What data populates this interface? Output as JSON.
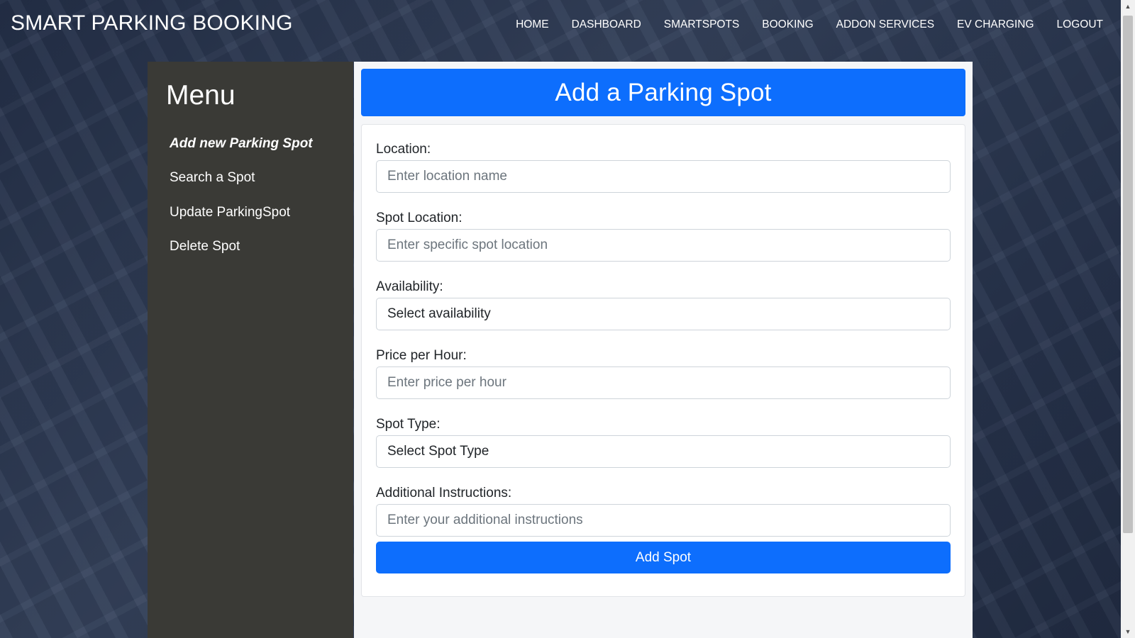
{
  "header": {
    "brand": "SMART PARKING BOOKING",
    "nav": [
      "HOME",
      "DASHBOARD",
      "SMARTSPOTS",
      "BOOKING",
      "ADDON SERVICES",
      "EV CHARGING",
      "LOGOUT"
    ]
  },
  "sidebar": {
    "title": "Menu",
    "items": [
      "Add new Parking Spot",
      "Search a Spot",
      "Update ParkingSpot",
      "Delete Spot"
    ],
    "active_index": 0
  },
  "main": {
    "title": "Add a Parking Spot",
    "form": {
      "location": {
        "label": "Location:",
        "placeholder": "Enter location name"
      },
      "spot_location": {
        "label": "Spot Location:",
        "placeholder": "Enter specific spot location"
      },
      "availability": {
        "label": "Availability:",
        "selected": "Select availability"
      },
      "price": {
        "label": "Price per Hour:",
        "placeholder": "Enter price per hour"
      },
      "spot_type": {
        "label": "Spot Type:",
        "selected": "Select Spot Type"
      },
      "instructions": {
        "label": "Additional Instructions:",
        "placeholder": "Enter your additional instructions"
      },
      "submit_label": "Add Spot"
    }
  },
  "colors": {
    "primary": "#0d6efd",
    "sidebar_bg": "#3a3a36",
    "panel_bg": "#f5f6f8",
    "text": "#212529",
    "placeholder": "#6c757d"
  }
}
